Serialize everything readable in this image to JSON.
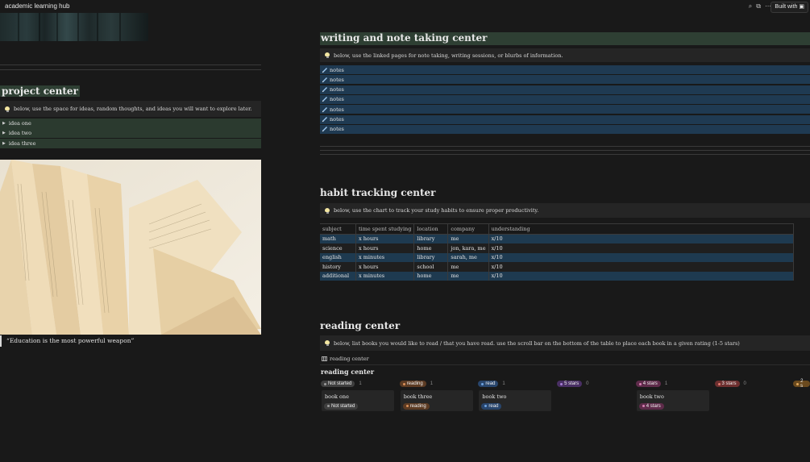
{
  "app": {
    "title": "academic learning hub",
    "built_with": "Built with"
  },
  "project": {
    "heading": "project center",
    "callout": "below, use the space for ideas, random thoughts, and ideas you will want to explore later.",
    "toggles": [
      "idea one",
      "idea two",
      "idea three"
    ],
    "quote": "“Education is the most powerful weapon”"
  },
  "writing": {
    "heading": "writing and note taking center",
    "callout": "below, use the linked pages for note taking, writing sessions, or blurbs of information.",
    "notes": [
      "notes",
      "notes",
      "notes",
      "notes",
      "notes",
      "notes",
      "notes"
    ]
  },
  "habit": {
    "heading": "habit tracking center",
    "callout": "below, use the chart to track your study habits to ensure proper productivity.",
    "columns": [
      "subject",
      "time spent studying",
      "location",
      "company",
      "understanding"
    ],
    "rows": [
      [
        "math",
        "x hours",
        "library",
        "me",
        "x/10"
      ],
      [
        "science",
        "x hours",
        "home",
        "jon, kara, me",
        "x/10"
      ],
      [
        "english",
        "x minutes",
        "library",
        "sarah, me",
        "x/10"
      ],
      [
        "history",
        "x hours",
        "school",
        "me",
        "x/10"
      ],
      [
        "additional",
        "x minutes",
        "home",
        "me",
        "x/10"
      ]
    ]
  },
  "reading": {
    "heading": "reading center",
    "callout": "below, list books you would like to read / that you have read. use the scroll bar on the bottom of the table to place each book in a given rating (1-5 stars)",
    "view_tab": "reading center",
    "board_title": "reading center",
    "columns": [
      {
        "label": "Not started",
        "count": "1",
        "bg": "#3f3f3f",
        "dot": "#9b9b9b",
        "card": {
          "title": "book one",
          "tag": "Not started"
        }
      },
      {
        "label": "reading",
        "count": "1",
        "bg": "#5c3b23",
        "dot": "#d9905a",
        "card": {
          "title": "book three",
          "tag": "reading"
        }
      },
      {
        "label": "read",
        "count": "1",
        "bg": "#28456c",
        "dot": "#6fa3e0",
        "card": {
          "title": "book two",
          "tag": "read"
        }
      },
      {
        "label": "5 stars",
        "count": "0",
        "bg": "#492f64",
        "dot": "#a77fd6",
        "card": null
      },
      {
        "label": "4 stars",
        "count": "1",
        "bg": "#5e2b4a",
        "dot": "#d77fb3",
        "card": {
          "title": "book two",
          "tag": "4 stars"
        }
      },
      {
        "label": "3 stars",
        "count": "0",
        "bg": "#6e2f2f",
        "dot": "#e0796f",
        "card": null
      },
      {
        "label": "2 s",
        "count": "",
        "bg": "#6b4a1e",
        "dot": "#e0a85a",
        "card": null
      }
    ]
  }
}
